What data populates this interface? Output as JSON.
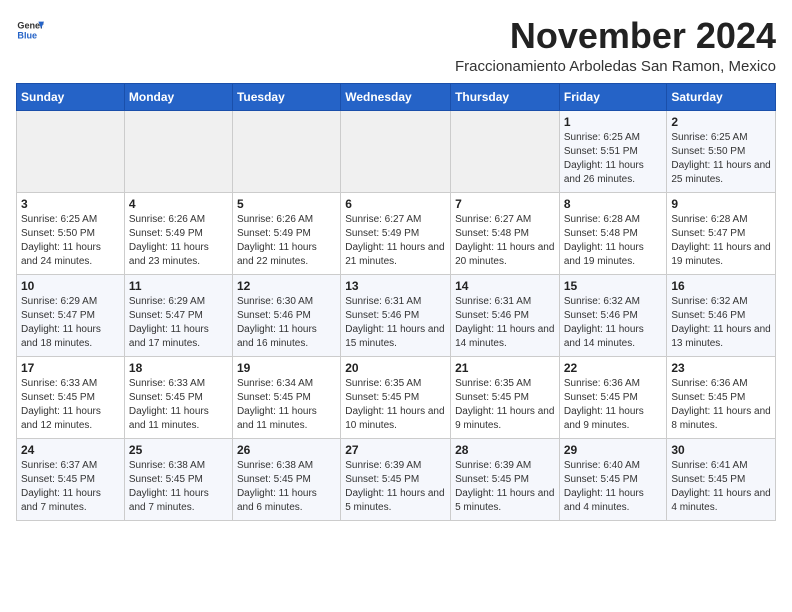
{
  "header": {
    "logo": {
      "general": "General",
      "blue": "Blue"
    },
    "title": "November 2024",
    "location": "Fraccionamiento Arboledas San Ramon, Mexico"
  },
  "calendar": {
    "days_of_week": [
      "Sunday",
      "Monday",
      "Tuesday",
      "Wednesday",
      "Thursday",
      "Friday",
      "Saturday"
    ],
    "weeks": [
      [
        {
          "day": "",
          "info": ""
        },
        {
          "day": "",
          "info": ""
        },
        {
          "day": "",
          "info": ""
        },
        {
          "day": "",
          "info": ""
        },
        {
          "day": "",
          "info": ""
        },
        {
          "day": "1",
          "info": "Sunrise: 6:25 AM\nSunset: 5:51 PM\nDaylight: 11 hours and 26 minutes."
        },
        {
          "day": "2",
          "info": "Sunrise: 6:25 AM\nSunset: 5:50 PM\nDaylight: 11 hours and 25 minutes."
        }
      ],
      [
        {
          "day": "3",
          "info": "Sunrise: 6:25 AM\nSunset: 5:50 PM\nDaylight: 11 hours and 24 minutes."
        },
        {
          "day": "4",
          "info": "Sunrise: 6:26 AM\nSunset: 5:49 PM\nDaylight: 11 hours and 23 minutes."
        },
        {
          "day": "5",
          "info": "Sunrise: 6:26 AM\nSunset: 5:49 PM\nDaylight: 11 hours and 22 minutes."
        },
        {
          "day": "6",
          "info": "Sunrise: 6:27 AM\nSunset: 5:49 PM\nDaylight: 11 hours and 21 minutes."
        },
        {
          "day": "7",
          "info": "Sunrise: 6:27 AM\nSunset: 5:48 PM\nDaylight: 11 hours and 20 minutes."
        },
        {
          "day": "8",
          "info": "Sunrise: 6:28 AM\nSunset: 5:48 PM\nDaylight: 11 hours and 19 minutes."
        },
        {
          "day": "9",
          "info": "Sunrise: 6:28 AM\nSunset: 5:47 PM\nDaylight: 11 hours and 19 minutes."
        }
      ],
      [
        {
          "day": "10",
          "info": "Sunrise: 6:29 AM\nSunset: 5:47 PM\nDaylight: 11 hours and 18 minutes."
        },
        {
          "day": "11",
          "info": "Sunrise: 6:29 AM\nSunset: 5:47 PM\nDaylight: 11 hours and 17 minutes."
        },
        {
          "day": "12",
          "info": "Sunrise: 6:30 AM\nSunset: 5:46 PM\nDaylight: 11 hours and 16 minutes."
        },
        {
          "day": "13",
          "info": "Sunrise: 6:31 AM\nSunset: 5:46 PM\nDaylight: 11 hours and 15 minutes."
        },
        {
          "day": "14",
          "info": "Sunrise: 6:31 AM\nSunset: 5:46 PM\nDaylight: 11 hours and 14 minutes."
        },
        {
          "day": "15",
          "info": "Sunrise: 6:32 AM\nSunset: 5:46 PM\nDaylight: 11 hours and 14 minutes."
        },
        {
          "day": "16",
          "info": "Sunrise: 6:32 AM\nSunset: 5:46 PM\nDaylight: 11 hours and 13 minutes."
        }
      ],
      [
        {
          "day": "17",
          "info": "Sunrise: 6:33 AM\nSunset: 5:45 PM\nDaylight: 11 hours and 12 minutes."
        },
        {
          "day": "18",
          "info": "Sunrise: 6:33 AM\nSunset: 5:45 PM\nDaylight: 11 hours and 11 minutes."
        },
        {
          "day": "19",
          "info": "Sunrise: 6:34 AM\nSunset: 5:45 PM\nDaylight: 11 hours and 11 minutes."
        },
        {
          "day": "20",
          "info": "Sunrise: 6:35 AM\nSunset: 5:45 PM\nDaylight: 11 hours and 10 minutes."
        },
        {
          "day": "21",
          "info": "Sunrise: 6:35 AM\nSunset: 5:45 PM\nDaylight: 11 hours and 9 minutes."
        },
        {
          "day": "22",
          "info": "Sunrise: 6:36 AM\nSunset: 5:45 PM\nDaylight: 11 hours and 9 minutes."
        },
        {
          "day": "23",
          "info": "Sunrise: 6:36 AM\nSunset: 5:45 PM\nDaylight: 11 hours and 8 minutes."
        }
      ],
      [
        {
          "day": "24",
          "info": "Sunrise: 6:37 AM\nSunset: 5:45 PM\nDaylight: 11 hours and 7 minutes."
        },
        {
          "day": "25",
          "info": "Sunrise: 6:38 AM\nSunset: 5:45 PM\nDaylight: 11 hours and 7 minutes."
        },
        {
          "day": "26",
          "info": "Sunrise: 6:38 AM\nSunset: 5:45 PM\nDaylight: 11 hours and 6 minutes."
        },
        {
          "day": "27",
          "info": "Sunrise: 6:39 AM\nSunset: 5:45 PM\nDaylight: 11 hours and 5 minutes."
        },
        {
          "day": "28",
          "info": "Sunrise: 6:39 AM\nSunset: 5:45 PM\nDaylight: 11 hours and 5 minutes."
        },
        {
          "day": "29",
          "info": "Sunrise: 6:40 AM\nSunset: 5:45 PM\nDaylight: 11 hours and 4 minutes."
        },
        {
          "day": "30",
          "info": "Sunrise: 6:41 AM\nSunset: 5:45 PM\nDaylight: 11 hours and 4 minutes."
        }
      ]
    ]
  }
}
